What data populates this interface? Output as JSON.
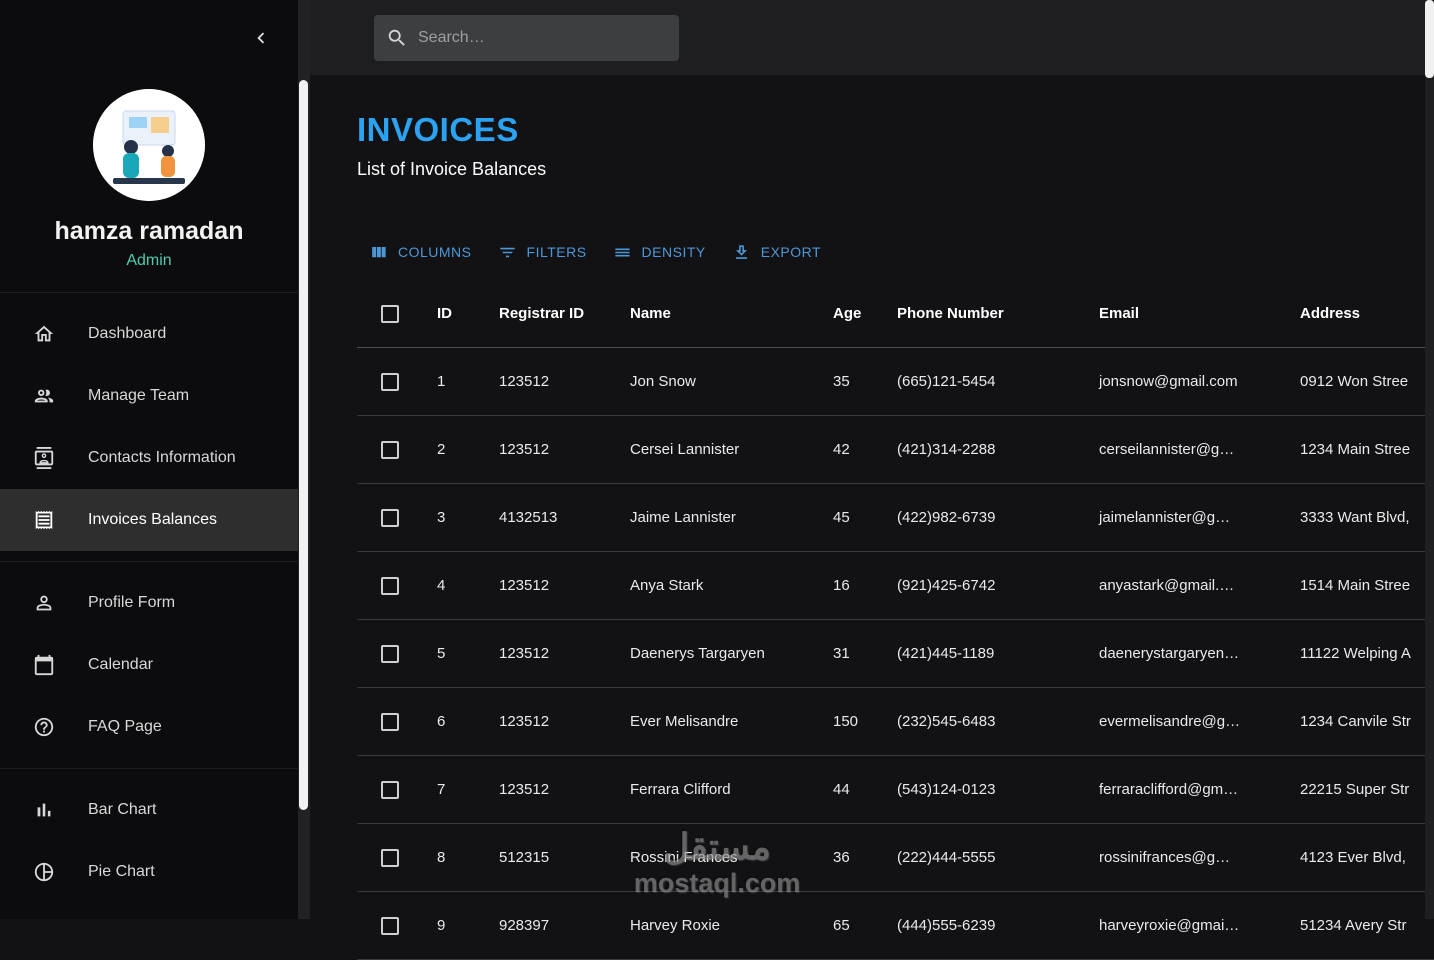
{
  "colors": {
    "title_accent": "#2BA3F2",
    "role_accent": "#4CCEAC",
    "toolbar_accent": "#4E97D6"
  },
  "sidebar": {
    "collapse_icon": "chevron-left-icon",
    "user": {
      "name": "hamza ramadan",
      "role": "Admin"
    },
    "sections": [
      {
        "items": [
          {
            "label": "Dashboard",
            "icon": "home-icon",
            "active": false
          },
          {
            "label": "Manage Team",
            "icon": "people-icon",
            "active": false
          },
          {
            "label": "Contacts Information",
            "icon": "contacts-icon",
            "active": false
          },
          {
            "label": "Invoices Balances",
            "icon": "receipt-icon",
            "active": true
          }
        ]
      },
      {
        "items": [
          {
            "label": "Profile Form",
            "icon": "person-icon",
            "active": false
          },
          {
            "label": "Calendar",
            "icon": "calendar-icon",
            "active": false
          },
          {
            "label": "FAQ Page",
            "icon": "help-icon",
            "active": false
          }
        ]
      },
      {
        "items": [
          {
            "label": "Bar Chart",
            "icon": "bar-chart-icon",
            "active": false
          },
          {
            "label": "Pie Chart",
            "icon": "pie-chart-icon",
            "active": false
          }
        ]
      }
    ]
  },
  "topbar": {
    "search_placeholder": "Search…",
    "search_icon": "search-icon"
  },
  "page": {
    "title": "INVOICES",
    "subtitle": "List of Invoice Balances"
  },
  "toolbar": {
    "buttons": [
      {
        "label": "COLUMNS",
        "icon": "columns-icon"
      },
      {
        "label": "FILTERS",
        "icon": "filter-icon"
      },
      {
        "label": "DENSITY",
        "icon": "density-icon"
      },
      {
        "label": "EXPORT",
        "icon": "export-icon"
      }
    ]
  },
  "table": {
    "columns": [
      {
        "key": "id",
        "label": "ID"
      },
      {
        "key": "registrarId",
        "label": "Registrar ID"
      },
      {
        "key": "name",
        "label": "Name"
      },
      {
        "key": "age",
        "label": "Age"
      },
      {
        "key": "phone",
        "label": "Phone Number"
      },
      {
        "key": "email",
        "label": "Email"
      },
      {
        "key": "address",
        "label": "Address"
      }
    ],
    "rows": [
      {
        "id": "1",
        "registrarId": "123512",
        "name": "Jon Snow",
        "age": "35",
        "phone": "(665)121-5454",
        "email": "jonsnow@gmail.com",
        "address": "0912 Won Stree"
      },
      {
        "id": "2",
        "registrarId": "123512",
        "name": "Cersei Lannister",
        "age": "42",
        "phone": "(421)314-2288",
        "email": "cerseilannister@g…",
        "address": "1234 Main Stree"
      },
      {
        "id": "3",
        "registrarId": "4132513",
        "name": "Jaime Lannister",
        "age": "45",
        "phone": "(422)982-6739",
        "email": "jaimelannister@g…",
        "address": "3333 Want Blvd,"
      },
      {
        "id": "4",
        "registrarId": "123512",
        "name": "Anya Stark",
        "age": "16",
        "phone": "(921)425-6742",
        "email": "anyastark@gmail.…",
        "address": "1514 Main Stree"
      },
      {
        "id": "5",
        "registrarId": "123512",
        "name": "Daenerys Targaryen",
        "age": "31",
        "phone": "(421)445-1189",
        "email": "daenerystargaryen…",
        "address": "11122 Welping A"
      },
      {
        "id": "6",
        "registrarId": "123512",
        "name": "Ever Melisandre",
        "age": "150",
        "phone": "(232)545-6483",
        "email": "evermelisandre@g…",
        "address": "1234 Canvile Str"
      },
      {
        "id": "7",
        "registrarId": "123512",
        "name": "Ferrara Clifford",
        "age": "44",
        "phone": "(543)124-0123",
        "email": "ferraraclifford@gm…",
        "address": "22215 Super Str"
      },
      {
        "id": "8",
        "registrarId": "512315",
        "name": "Rossini Frances",
        "age": "36",
        "phone": "(222)444-5555",
        "email": "rossinifrances@g…",
        "address": "4123 Ever Blvd,"
      },
      {
        "id": "9",
        "registrarId": "928397",
        "name": "Harvey Roxie",
        "age": "65",
        "phone": "(444)555-6239",
        "email": "harveyroxie@gmai…",
        "address": "51234 Avery Str"
      }
    ]
  },
  "watermark": {
    "line1": "مستقل",
    "line2": "mostaql.com"
  }
}
